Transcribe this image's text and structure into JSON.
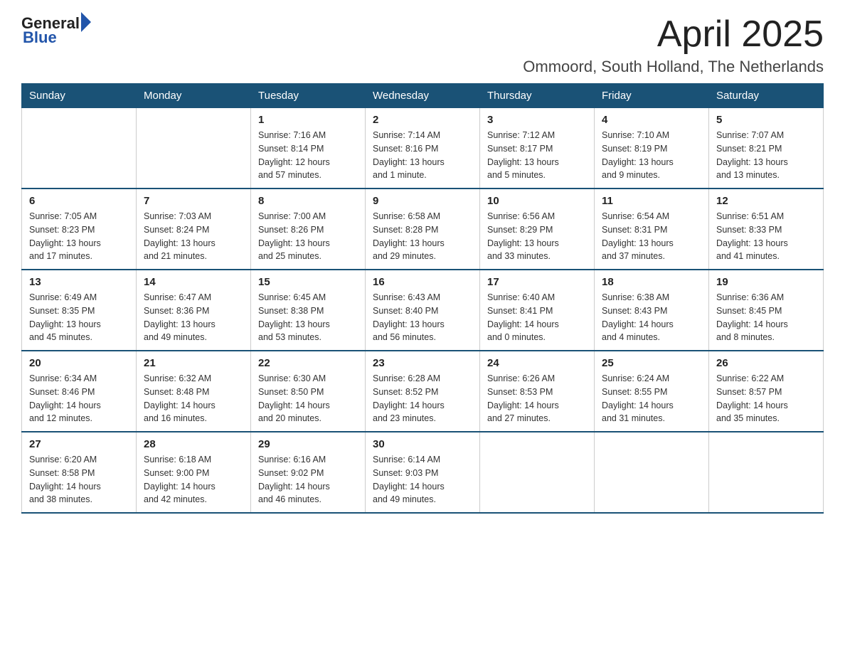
{
  "logo": {
    "text_general": "General",
    "triangle": "▶",
    "text_blue": "Blue"
  },
  "title": {
    "month_year": "April 2025",
    "location": "Ommoord, South Holland, The Netherlands"
  },
  "weekdays": [
    "Sunday",
    "Monday",
    "Tuesday",
    "Wednesday",
    "Thursday",
    "Friday",
    "Saturday"
  ],
  "weeks": [
    [
      {
        "day": "",
        "info": ""
      },
      {
        "day": "",
        "info": ""
      },
      {
        "day": "1",
        "info": "Sunrise: 7:16 AM\nSunset: 8:14 PM\nDaylight: 12 hours\nand 57 minutes."
      },
      {
        "day": "2",
        "info": "Sunrise: 7:14 AM\nSunset: 8:16 PM\nDaylight: 13 hours\nand 1 minute."
      },
      {
        "day": "3",
        "info": "Sunrise: 7:12 AM\nSunset: 8:17 PM\nDaylight: 13 hours\nand 5 minutes."
      },
      {
        "day": "4",
        "info": "Sunrise: 7:10 AM\nSunset: 8:19 PM\nDaylight: 13 hours\nand 9 minutes."
      },
      {
        "day": "5",
        "info": "Sunrise: 7:07 AM\nSunset: 8:21 PM\nDaylight: 13 hours\nand 13 minutes."
      }
    ],
    [
      {
        "day": "6",
        "info": "Sunrise: 7:05 AM\nSunset: 8:23 PM\nDaylight: 13 hours\nand 17 minutes."
      },
      {
        "day": "7",
        "info": "Sunrise: 7:03 AM\nSunset: 8:24 PM\nDaylight: 13 hours\nand 21 minutes."
      },
      {
        "day": "8",
        "info": "Sunrise: 7:00 AM\nSunset: 8:26 PM\nDaylight: 13 hours\nand 25 minutes."
      },
      {
        "day": "9",
        "info": "Sunrise: 6:58 AM\nSunset: 8:28 PM\nDaylight: 13 hours\nand 29 minutes."
      },
      {
        "day": "10",
        "info": "Sunrise: 6:56 AM\nSunset: 8:29 PM\nDaylight: 13 hours\nand 33 minutes."
      },
      {
        "day": "11",
        "info": "Sunrise: 6:54 AM\nSunset: 8:31 PM\nDaylight: 13 hours\nand 37 minutes."
      },
      {
        "day": "12",
        "info": "Sunrise: 6:51 AM\nSunset: 8:33 PM\nDaylight: 13 hours\nand 41 minutes."
      }
    ],
    [
      {
        "day": "13",
        "info": "Sunrise: 6:49 AM\nSunset: 8:35 PM\nDaylight: 13 hours\nand 45 minutes."
      },
      {
        "day": "14",
        "info": "Sunrise: 6:47 AM\nSunset: 8:36 PM\nDaylight: 13 hours\nand 49 minutes."
      },
      {
        "day": "15",
        "info": "Sunrise: 6:45 AM\nSunset: 8:38 PM\nDaylight: 13 hours\nand 53 minutes."
      },
      {
        "day": "16",
        "info": "Sunrise: 6:43 AM\nSunset: 8:40 PM\nDaylight: 13 hours\nand 56 minutes."
      },
      {
        "day": "17",
        "info": "Sunrise: 6:40 AM\nSunset: 8:41 PM\nDaylight: 14 hours\nand 0 minutes."
      },
      {
        "day": "18",
        "info": "Sunrise: 6:38 AM\nSunset: 8:43 PM\nDaylight: 14 hours\nand 4 minutes."
      },
      {
        "day": "19",
        "info": "Sunrise: 6:36 AM\nSunset: 8:45 PM\nDaylight: 14 hours\nand 8 minutes."
      }
    ],
    [
      {
        "day": "20",
        "info": "Sunrise: 6:34 AM\nSunset: 8:46 PM\nDaylight: 14 hours\nand 12 minutes."
      },
      {
        "day": "21",
        "info": "Sunrise: 6:32 AM\nSunset: 8:48 PM\nDaylight: 14 hours\nand 16 minutes."
      },
      {
        "day": "22",
        "info": "Sunrise: 6:30 AM\nSunset: 8:50 PM\nDaylight: 14 hours\nand 20 minutes."
      },
      {
        "day": "23",
        "info": "Sunrise: 6:28 AM\nSunset: 8:52 PM\nDaylight: 14 hours\nand 23 minutes."
      },
      {
        "day": "24",
        "info": "Sunrise: 6:26 AM\nSunset: 8:53 PM\nDaylight: 14 hours\nand 27 minutes."
      },
      {
        "day": "25",
        "info": "Sunrise: 6:24 AM\nSunset: 8:55 PM\nDaylight: 14 hours\nand 31 minutes."
      },
      {
        "day": "26",
        "info": "Sunrise: 6:22 AM\nSunset: 8:57 PM\nDaylight: 14 hours\nand 35 minutes."
      }
    ],
    [
      {
        "day": "27",
        "info": "Sunrise: 6:20 AM\nSunset: 8:58 PM\nDaylight: 14 hours\nand 38 minutes."
      },
      {
        "day": "28",
        "info": "Sunrise: 6:18 AM\nSunset: 9:00 PM\nDaylight: 14 hours\nand 42 minutes."
      },
      {
        "day": "29",
        "info": "Sunrise: 6:16 AM\nSunset: 9:02 PM\nDaylight: 14 hours\nand 46 minutes."
      },
      {
        "day": "30",
        "info": "Sunrise: 6:14 AM\nSunset: 9:03 PM\nDaylight: 14 hours\nand 49 minutes."
      },
      {
        "day": "",
        "info": ""
      },
      {
        "day": "",
        "info": ""
      },
      {
        "day": "",
        "info": ""
      }
    ]
  ]
}
